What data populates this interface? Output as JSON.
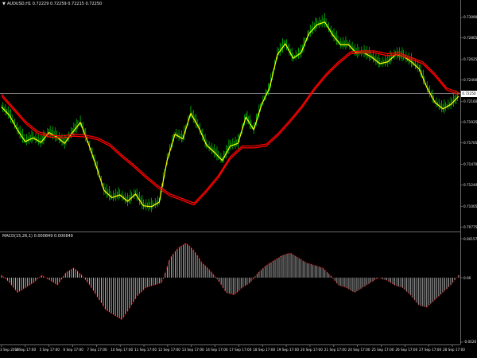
{
  "chart_title": "AUDUSD,H1  0.72229 0.72259 0.72215 0.72250",
  "macd_title": "MACD(15,26,1) 0.000849 0.000849",
  "current_price": "0.72250",
  "title_arrow_icon": "triangle-down-icon",
  "colors": {
    "background": "#000000",
    "price_line": "#ffff00",
    "price_wick": "#00c000",
    "ma_line": "#ff0000",
    "histogram": "#c0c0c0",
    "signal": "#ff0000",
    "hline": "#c0c0c0",
    "axis_text": "#e8e8e8"
  },
  "chart_data": [
    {
      "type": "line",
      "title": "AUDUSD,H1  0.72229 0.72259 0.72215 0.72250",
      "x": [
        "3 Sep 2018",
        "4 Sep 17:00",
        "5 Sep 17:00",
        "6 Sep 17:00",
        "7 Sep 17:00",
        "10 Sep 17:00",
        "11 Sep 17:00",
        "12 Sep 17:00",
        "13 Sep 17:00",
        "14 Sep 17:00",
        "17 Sep 17:00",
        "18 Sep 17:00",
        "19 Sep 17:00",
        "20 Sep 17:00",
        "21 Sep 17:00",
        "24 Sep 17:00",
        "25 Sep 17:00",
        "26 Sep 17:00",
        "27 Sep 17:00",
        "28 Sep 17:00"
      ],
      "y_ticks": [
        "0.73090",
        "0.72865",
        "0.72625",
        "0.72400",
        "0.72160",
        "0.71935",
        "0.71705",
        "0.71470",
        "0.71240",
        "0.71005",
        "0.70775"
      ],
      "ylim": [
        0.7077,
        0.7316
      ],
      "current_price": "0.72250",
      "series": [
        {
          "values": [
            0.721,
            0.7201,
            0.7185,
            0.7172,
            0.7176,
            0.7171,
            0.7182,
            0.7177,
            0.717,
            0.7182,
            0.7193,
            0.717,
            0.7145,
            0.7118,
            0.711,
            0.7113,
            0.7106,
            0.7114,
            0.7101,
            0.71,
            0.7105,
            0.7151,
            0.718,
            0.7175,
            0.7203,
            0.7188,
            0.7168,
            0.716,
            0.7151,
            0.7167,
            0.717,
            0.7199,
            0.7185,
            0.7213,
            0.7231,
            0.7268,
            0.728,
            0.7264,
            0.727,
            0.7291,
            0.7301,
            0.7304,
            0.729,
            0.7279,
            0.7279,
            0.727,
            0.727,
            0.7265,
            0.7258,
            0.726,
            0.7268,
            0.7266,
            0.726,
            0.7252,
            0.7231,
            0.7215,
            0.7208,
            0.7213,
            0.7222
          ]
        },
        {
          "values": [
            0.7223,
            0.7208,
            0.7193,
            0.7182,
            0.7178,
            0.7177,
            0.7179,
            0.7178,
            0.7175,
            0.7168,
            0.7156,
            0.7145,
            0.7133,
            0.7122,
            0.7113,
            0.7108,
            0.7103,
            0.7117,
            0.7133,
            0.7154,
            0.7166,
            0.7166,
            0.7168,
            0.718,
            0.7195,
            0.7211,
            0.723,
            0.7246,
            0.7259,
            0.727,
            0.7271,
            0.7271,
            0.7268,
            0.7269,
            0.7264,
            0.7259,
            0.7246,
            0.723,
            0.7225
          ]
        }
      ]
    },
    {
      "type": "bar",
      "title": "MACD(15,26,1) 0.000849 0.000849",
      "y_ticks": [
        "0.0015735",
        "0.00",
        "-0.0026"
      ],
      "ylim": [
        -0.0026,
        0.0015735
      ],
      "values": [
        0.0001,
        -0.0002,
        -0.0006,
        -0.0004,
        -0.0002,
        0.0001,
        -0.0001,
        -0.0003,
        0.0002,
        0.0004,
        0.0001,
        -0.0003,
        -0.0008,
        -0.0013,
        -0.0015,
        -0.0017,
        -0.0012,
        -0.0007,
        -0.0004,
        -0.0003,
        -0.0002,
        0.0008,
        0.0012,
        0.0014,
        0.0011,
        0.0006,
        0.0003,
        -0.0001,
        -0.0006,
        -0.0007,
        -0.0004,
        -0.0002,
        0.0002,
        0.0005,
        0.0007,
        0.0009,
        0.001,
        0.0008,
        0.0006,
        0.0005,
        0.0004,
        0.0001,
        -0.0003,
        -0.0004,
        -0.0006,
        -0.0004,
        -0.0002,
        0.0,
        -0.0001,
        -0.0003,
        -0.0004,
        -0.0007,
        -0.0011,
        -0.0012,
        -0.0009,
        -0.0006,
        -0.0003,
        0.0001
      ]
    }
  ]
}
